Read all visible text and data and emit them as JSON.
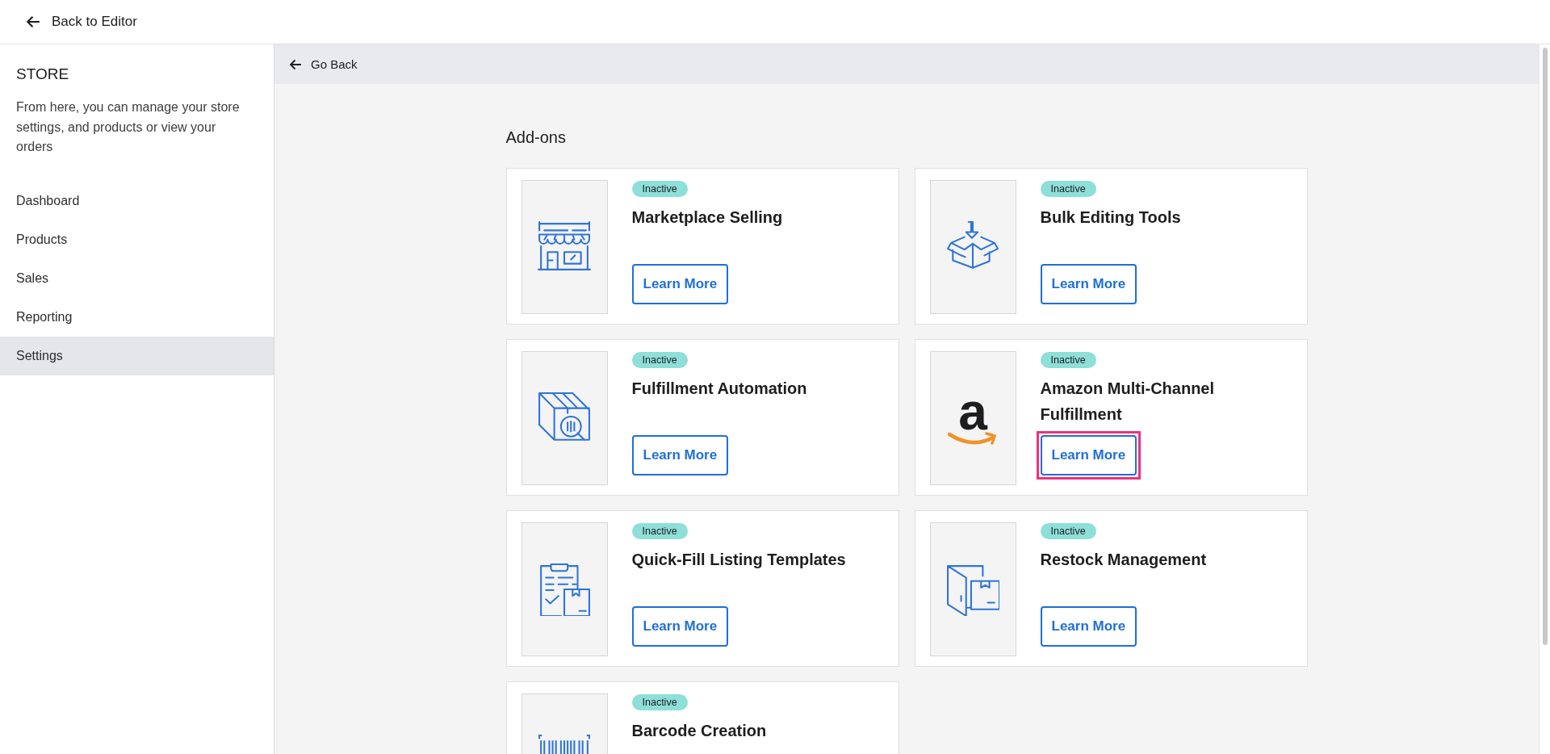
{
  "top_bar": {
    "back_label": "Back to Editor"
  },
  "sidebar": {
    "title": "STORE",
    "description": "From here, you can manage your store settings, and products or view your orders",
    "items": [
      {
        "label": "Dashboard",
        "selected": false
      },
      {
        "label": "Products",
        "selected": false
      },
      {
        "label": "Sales",
        "selected": false
      },
      {
        "label": "Reporting",
        "selected": false
      },
      {
        "label": "Settings",
        "selected": true
      }
    ]
  },
  "go_back": {
    "label": "Go Back"
  },
  "section_title": "Add-ons",
  "addons": [
    {
      "kind": "store",
      "status": "Inactive",
      "title": "Marketplace Selling",
      "button": "Learn More",
      "highlighted": false
    },
    {
      "kind": "download",
      "status": "Inactive",
      "title": "Bulk Editing Tools",
      "button": "Learn More",
      "highlighted": false
    },
    {
      "kind": "automation",
      "status": "Inactive",
      "title": "Fulfillment Automation",
      "button": "Learn More",
      "highlighted": false
    },
    {
      "kind": "logo",
      "logo_text": "a",
      "status": "Inactive",
      "title": "Amazon Multi-Channel Fulfillment",
      "button": "Learn More",
      "highlighted": true
    },
    {
      "kind": "template",
      "status": "Inactive",
      "title": "Quick-Fill Listing Templates",
      "button": "Learn More",
      "highlighted": false
    },
    {
      "kind": "restock",
      "status": "Inactive",
      "title": "Restock Management",
      "button": "Learn More",
      "highlighted": false
    },
    {
      "kind": "barcode",
      "status": "Inactive",
      "title": "Barcode Creation"
    }
  ]
}
